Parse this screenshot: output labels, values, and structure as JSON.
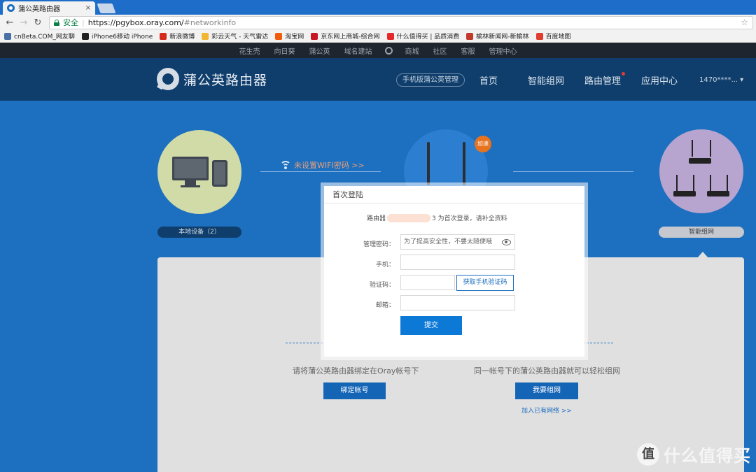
{
  "browser": {
    "tab_title": "蒲公英路由器",
    "tab_close": "×",
    "secure_label": "安全",
    "url": "https://pgybox.oray.com/",
    "url_hash": "#networkinfo",
    "bookmarks": [
      {
        "label": "cnBeta.COM_网友聊",
        "icon_color": "#4a6fa5"
      },
      {
        "label": "iPhone6移动 iPhone",
        "icon_color": "#222222"
      },
      {
        "label": "新浪微博",
        "icon_color": "#d52b1e"
      },
      {
        "label": "彩云天气 - 天气雷达",
        "icon_color": "#f2b632"
      },
      {
        "label": "淘宝网",
        "icon_color": "#f25b0a"
      },
      {
        "label": "京东网上商城-综合网",
        "icon_color": "#c81623"
      },
      {
        "label": "什么值得买 | 品质消费",
        "icon_color": "#e62828"
      },
      {
        "label": "榆林新闻网-新榆林",
        "icon_color": "#c0392b"
      },
      {
        "label": "百度地图",
        "icon_color": "#e03c31"
      }
    ]
  },
  "topnav": {
    "links_left": [
      "花生壳",
      "向日葵",
      "蒲公英",
      "域名建站"
    ],
    "links_right": [
      "商城",
      "社区",
      "客服",
      "管理中心"
    ]
  },
  "header": {
    "brand": "蒲公英路由器",
    "mobile_manage": "手机版蒲公英管理",
    "nav": [
      "首页",
      "智能组网",
      "路由管理",
      "应用中心"
    ],
    "account": "1470****... ▾"
  },
  "network": {
    "wifi_warning": "未设置WIFI密码 >>",
    "speed_badge": "加速",
    "local_devices": "本地设备（2）",
    "mesh_label": "智能组网"
  },
  "panel": {
    "bind_text": "请将蒲公英路由器绑定在Oray帐号下",
    "bind_button": "绑定帐号",
    "mesh_text": "同一帐号下的蒲公英路由器就可以轻松组网",
    "mesh_button": "我要组网",
    "join_link": "加入已有网络 >>"
  },
  "dialog": {
    "title": "首次登陆",
    "intro_prefix": "路由器",
    "intro_suffix": "3 为首次登录，请补全资料",
    "password_label": "管理密码：",
    "password_placeholder": "为了提高安全性，不要太随便哦",
    "phone_label": "手机：",
    "phone_value": "",
    "code_label": "验证码：",
    "code_value": "",
    "get_code_button": "获取手机验证码",
    "email_label": "邮箱：",
    "email_value": "",
    "submit_button": "提交"
  },
  "watermark": {
    "icon_text": "值",
    "text": "什么值得买"
  }
}
